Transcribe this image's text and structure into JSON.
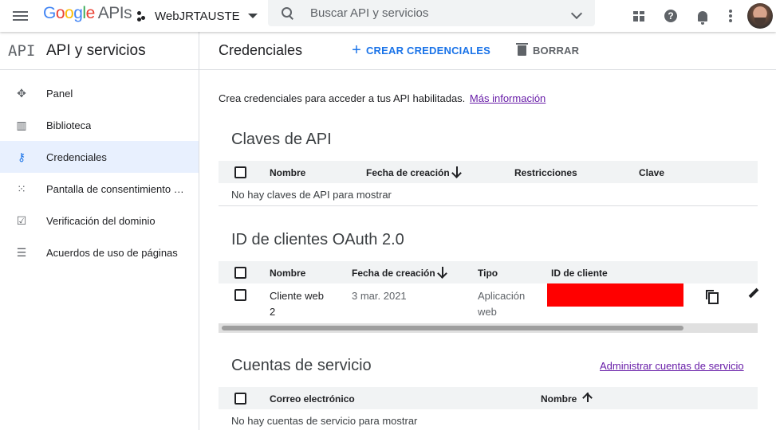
{
  "topbar": {
    "logo": {
      "g1": "G",
      "g2": "o",
      "g3": "o",
      "g4": "g",
      "g5": "l",
      "g6": "e",
      "apis": "APIs"
    },
    "project_name": "WebJRTAUSTE",
    "search_placeholder": "Buscar API y servicios",
    "help_glyph": "?"
  },
  "sidebar": {
    "api_logo": "API",
    "title": "API y servicios",
    "items": [
      {
        "label": "Panel",
        "icon": "✥"
      },
      {
        "label": "Biblioteca",
        "icon": "▥"
      },
      {
        "label": "Credenciales",
        "icon": "⚷"
      },
      {
        "label": "Pantalla de consentimiento de OAuth",
        "icon": "⁙"
      },
      {
        "label": "Verificación del dominio",
        "icon": "☑"
      },
      {
        "label": "Acuerdos de uso de páginas",
        "icon": "☰"
      }
    ]
  },
  "main": {
    "title": "Credenciales",
    "create_button": "CREAR CREDENCIALES",
    "create_plus": "+",
    "delete_button": "BORRAR",
    "intro_text": "Crea credenciales para acceder a tus API habilitadas.",
    "intro_link": "Más información",
    "api_keys": {
      "title": "Claves de API",
      "columns": [
        "Nombre",
        "Fecha de creación",
        "Restricciones",
        "Clave"
      ],
      "empty": "No hay claves de API para mostrar"
    },
    "oauth": {
      "title": "ID de clientes OAuth 2.0",
      "columns": [
        "Nombre",
        "Fecha de creación",
        "Tipo",
        "ID de cliente"
      ],
      "rows": [
        {
          "name_line1": "Cliente web",
          "name_line2": "2",
          "date": "3 mar. 2021",
          "type_line1": "Aplicación",
          "type_line2": "web"
        }
      ]
    },
    "service_accounts": {
      "title": "Cuentas de servicio",
      "manage_link": "Administrar cuentas de servicio",
      "columns": [
        "Correo electrónico",
        "Nombre"
      ],
      "empty": "No hay cuentas de servicio para mostrar"
    }
  },
  "colors": {
    "accent": "#1a73e8",
    "link_visited": "#681da8",
    "active_nav_bg": "#e8f0fe",
    "redaction": "#ff0000"
  }
}
